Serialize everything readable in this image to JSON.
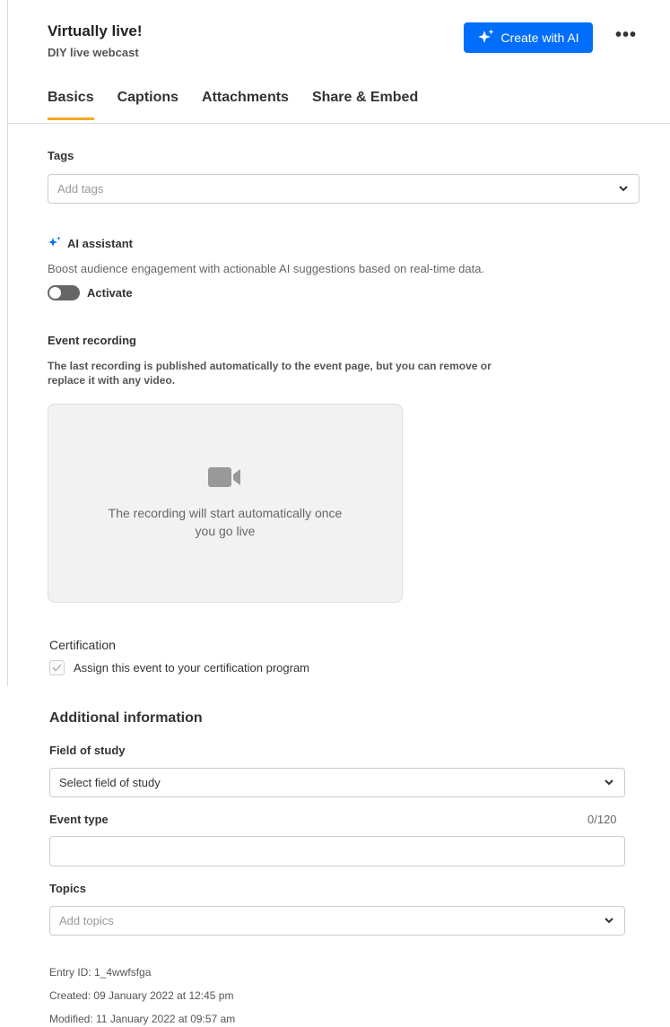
{
  "header": {
    "title": "Virtually live!",
    "subtitle": "DIY live webcast",
    "create_ai_label": "Create with AI",
    "more_label": "•••"
  },
  "tabs": [
    {
      "label": "Basics",
      "active": true
    },
    {
      "label": "Captions",
      "active": false
    },
    {
      "label": "Attachments",
      "active": false
    },
    {
      "label": "Share & Embed",
      "active": false
    }
  ],
  "tags": {
    "label": "Tags",
    "placeholder": "Add tags"
  },
  "ai_assistant": {
    "label": "AI assistant",
    "description": "Boost audience engagement with actionable AI suggestions based on real-time data.",
    "toggle_label": "Activate",
    "toggle_on": false
  },
  "event_recording": {
    "label": "Event recording",
    "description": "The last recording is published automatically to the event page, but you can remove or replace it with any video.",
    "placeholder_text": "The recording will start automatically once you go live"
  },
  "certification": {
    "label": "Certification",
    "checkbox_label": "Assign this event to your certification program",
    "checked": true
  },
  "additional_info": {
    "title": "Additional information",
    "field_of_study": {
      "label": "Field of study",
      "value": "Select field of study"
    },
    "event_type": {
      "label": "Event type",
      "counter": "0/120",
      "value": ""
    },
    "topics": {
      "label": "Topics",
      "placeholder": "Add topics"
    }
  },
  "meta": {
    "entry_id": "Entry ID: 1_4wwfsfga",
    "created": "Created: 09 January 2022 at 12:45 pm",
    "modified": "Modified: 11 January 2022 at 09:57 am"
  },
  "colors": {
    "accent_blue": "#006efa",
    "tab_underline": "#f5a623"
  },
  "icons": {
    "ai": "sparkle-icon",
    "chevron": "chevron-down-icon",
    "video": "video-camera-icon",
    "check": "check-icon"
  }
}
